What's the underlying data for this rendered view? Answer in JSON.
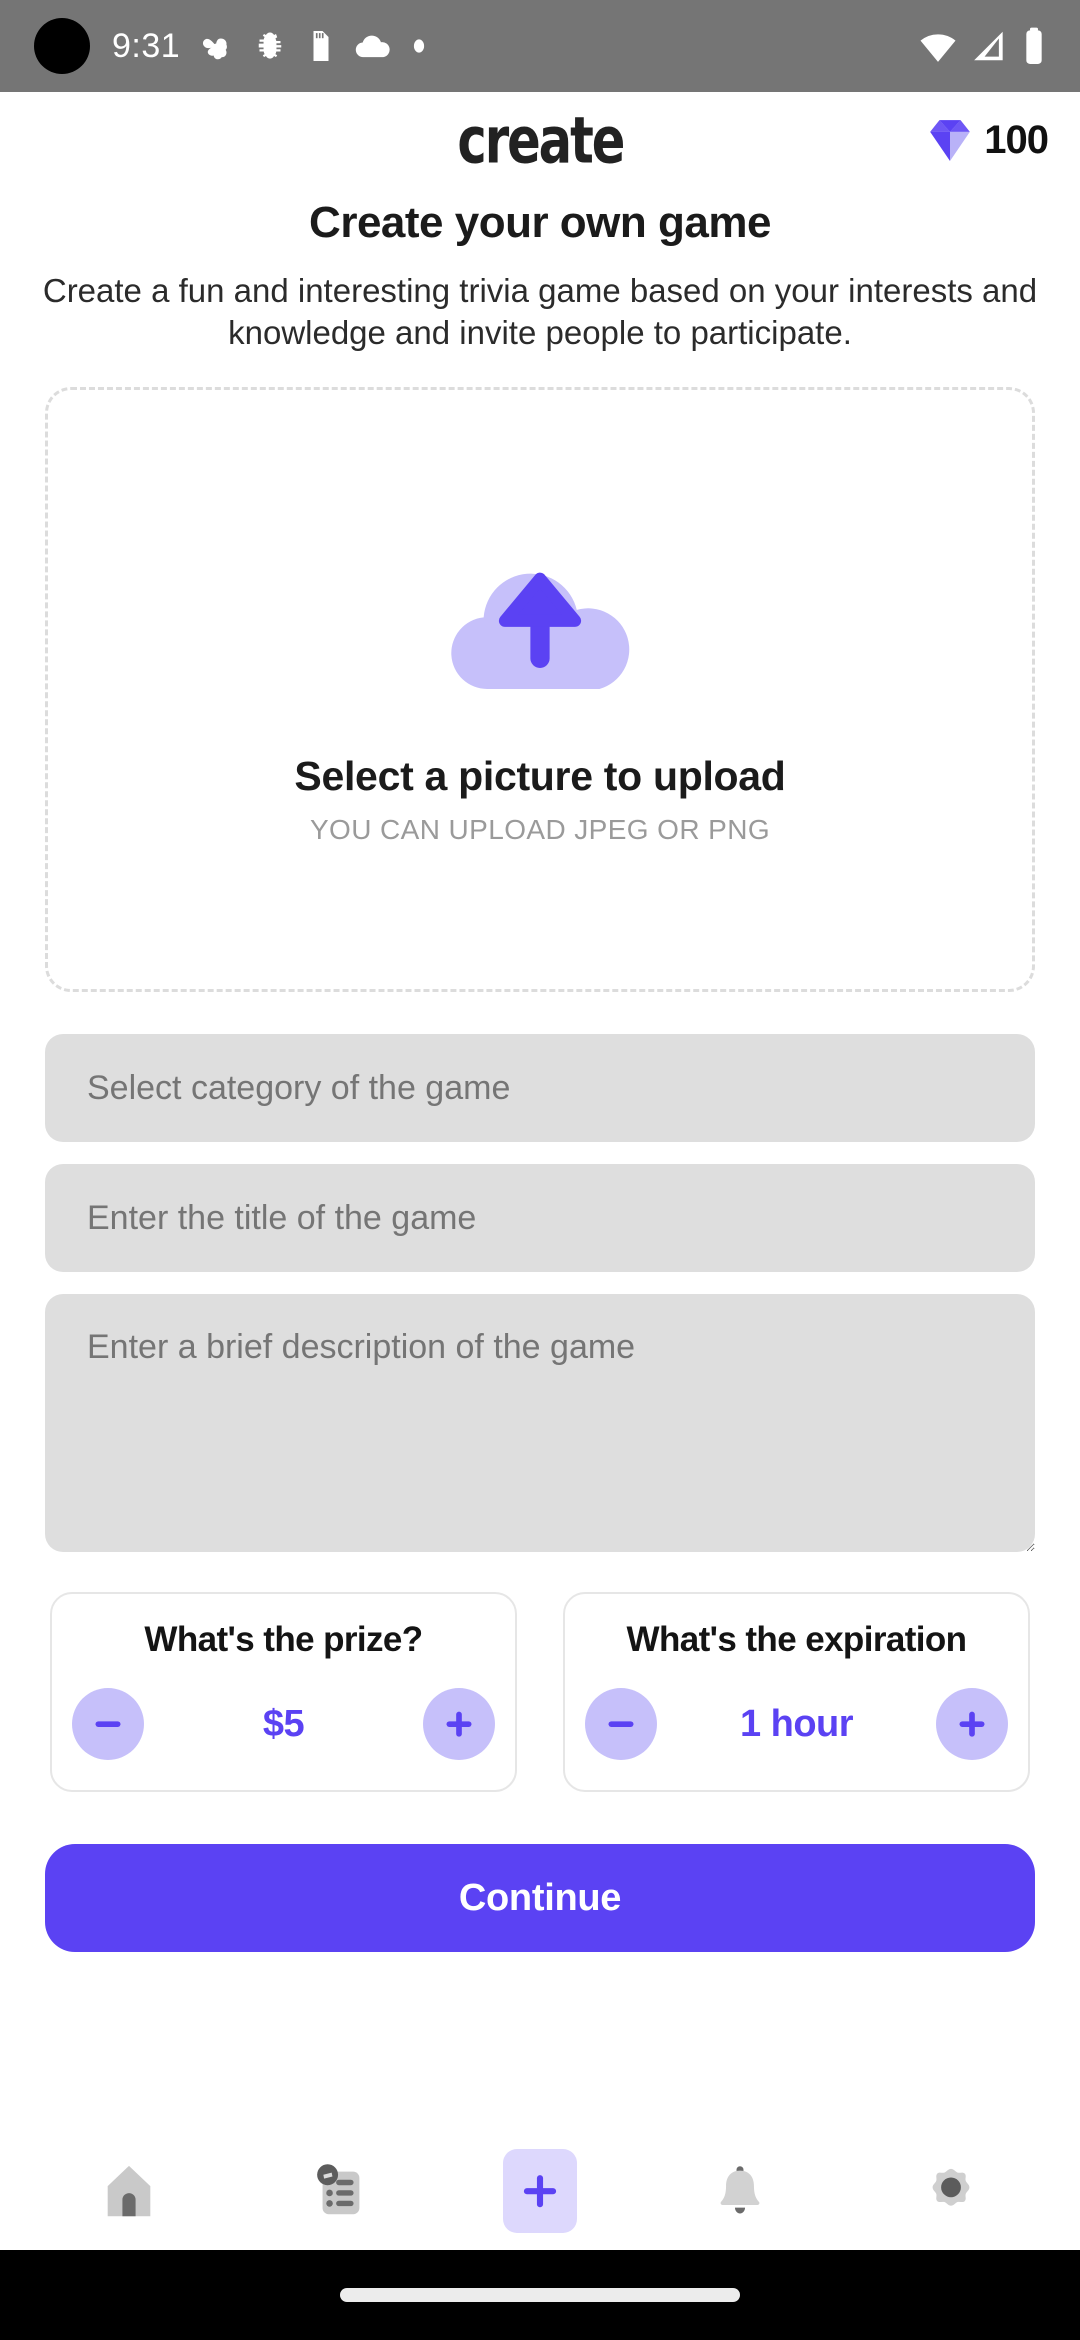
{
  "status_bar": {
    "time": "9:31",
    "left_icons": [
      "fan-icon",
      "bug-icon",
      "sd-card-icon",
      "cloud-icon",
      "dot-icon"
    ],
    "right_icons": [
      "wifi-icon",
      "signal-icon",
      "battery-icon"
    ]
  },
  "header": {
    "logo": "create",
    "coin_count": "100",
    "coin_icon": "diamond-icon"
  },
  "page": {
    "title": "Create your own game",
    "subtitle": "Create a fun and interesting trivia game based on your interests and knowledge and invite people to participate."
  },
  "upload": {
    "icon": "cloud-upload-icon",
    "title": "Select a picture to upload",
    "hint": "YOU CAN UPLOAD JPEG OR PNG"
  },
  "form": {
    "category_placeholder": "Select category of the game",
    "category_value": "",
    "title_placeholder": "Enter the title of the game",
    "title_value": "",
    "description_placeholder": "Enter a brief description of the game",
    "description_value": ""
  },
  "steppers": [
    {
      "title": "What's the prize?",
      "value": "$5",
      "decrement_icon": "minus-icon",
      "increment_icon": "plus-icon"
    },
    {
      "title": "What's the expiration",
      "value": "1 hour",
      "decrement_icon": "minus-icon",
      "increment_icon": "plus-icon"
    }
  ],
  "actions": {
    "continue_label": "Continue"
  },
  "bottom_nav": {
    "items": [
      {
        "name": "home",
        "icon": "home-icon",
        "active": false
      },
      {
        "name": "quizzes",
        "icon": "clipboard-list-icon",
        "active": false
      },
      {
        "name": "create",
        "icon": "plus-icon",
        "active": true
      },
      {
        "name": "notifications",
        "icon": "bell-icon",
        "active": false
      },
      {
        "name": "settings",
        "icon": "gear-icon",
        "active": false
      }
    ]
  },
  "colors": {
    "accent": "#5b42f3",
    "accent_light": "#c6c0fa",
    "accent_pale": "#ddd8fd",
    "field_bg": "#dedede",
    "status_bar_bg": "#757575",
    "muted_text": "#9a9a9a"
  }
}
